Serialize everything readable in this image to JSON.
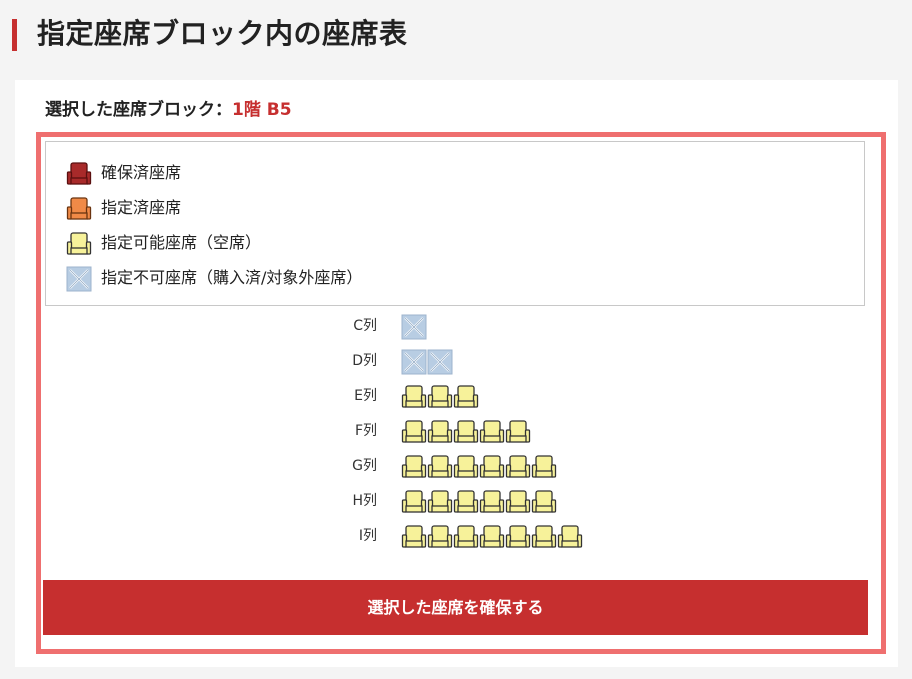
{
  "page": {
    "title": "指定座席ブロック内の座席表"
  },
  "selected": {
    "label": "選択した座席ブロック：",
    "value": "1階 B5"
  },
  "colors": {
    "accent": "#c62f2f",
    "frame": "#ef6f6f",
    "reserved": "#a82a2a",
    "designated": "#f08a47",
    "available": "#f7f29a",
    "unavailable": "#b8cde3"
  },
  "legend": [
    {
      "status": "reserved",
      "icon": "reserved-seat-icon",
      "label": "確保済座席"
    },
    {
      "status": "designated",
      "icon": "designated-seat-icon",
      "label": "指定済座席"
    },
    {
      "status": "available",
      "icon": "available-seat-icon",
      "label": "指定可能座席（空席）"
    },
    {
      "status": "unavailable",
      "icon": "unavailable-seat-icon",
      "label": "指定不可座席（購入済/対象外座席）"
    }
  ],
  "rows": [
    {
      "label": "C列",
      "seats": [
        "unavailable"
      ]
    },
    {
      "label": "D列",
      "seats": [
        "unavailable",
        "unavailable"
      ]
    },
    {
      "label": "E列",
      "seats": [
        "available",
        "available",
        "available"
      ]
    },
    {
      "label": "F列",
      "seats": [
        "available",
        "available",
        "available",
        "available",
        "available"
      ]
    },
    {
      "label": "G列",
      "seats": [
        "available",
        "available",
        "available",
        "available",
        "available",
        "available"
      ]
    },
    {
      "label": "H列",
      "seats": [
        "available",
        "available",
        "available",
        "available",
        "available",
        "available"
      ]
    },
    {
      "label": "I列",
      "seats": [
        "available",
        "available",
        "available",
        "available",
        "available",
        "available",
        "available"
      ]
    }
  ],
  "confirm_button": "選択した座席を確保する"
}
